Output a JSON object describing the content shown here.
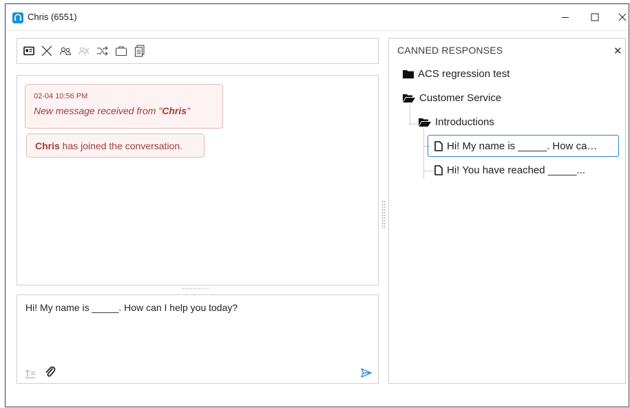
{
  "window": {
    "title": "Chris (6551)"
  },
  "messages": [
    {
      "timestamp": "02-04 10:56 PM",
      "text_prefix": "New message received from \"",
      "sender": "Chris",
      "text_suffix": "\""
    },
    {
      "sender": "Chris",
      "text": " has joined the conversation."
    }
  ],
  "compose": {
    "value": "Hi! My name is _____. How can I help you today?"
  },
  "canned": {
    "title": "CANNED RESPONSES",
    "close_glyph": "✕",
    "tree": {
      "folder_1": "ACS regression test",
      "folder_2": "Customer Service",
      "subfolder": "Introductions",
      "item_1": "Hi! My name is _____. How ca…",
      "item_2": "Hi! You have reached _____..."
    }
  },
  "colors": {
    "accent": "#1592d4",
    "message_text": "#a33a3a",
    "message_bg": "#fdf3f3",
    "selection_border": "#2a7fd4"
  },
  "icons": {
    "toolbar": [
      "contact-card-icon",
      "end-chat-icon",
      "transfer-agent-icon",
      "conference-icon",
      "reroute-icon",
      "hold-icon",
      "transcript-icon"
    ],
    "compose": [
      "format-text-icon",
      "attachment-icon",
      "send-icon"
    ]
  }
}
